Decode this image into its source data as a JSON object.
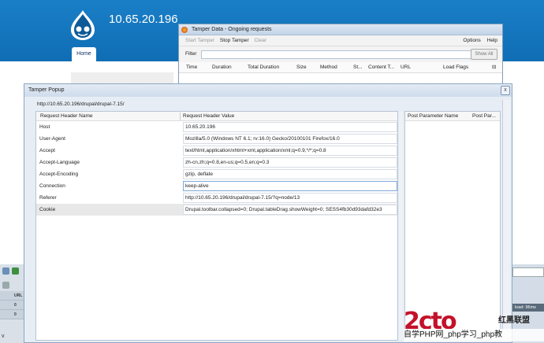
{
  "site": {
    "ip": "10.65.20.196",
    "home_tab": "Home",
    "corner_mark": "v"
  },
  "firefox_strip": {
    "row1": "URL",
    "row2": "0",
    "row3": "0"
  },
  "load_status": "load: 96ms",
  "tamper_data": {
    "title": "Tamper Data - Ongoing requests",
    "menu": {
      "start": "Start Tamper",
      "stop": "Stop Tamper",
      "clear": "Clear",
      "options": "Options",
      "help": "Help"
    },
    "filter_label": "Filter",
    "show_all": "Show All",
    "columns": [
      "Time",
      "Duration",
      "Total Duration",
      "Size",
      "Method",
      "St...",
      "Content T...",
      "URL",
      "Load Flags"
    ]
  },
  "popup": {
    "title": "Tamper Popup",
    "url": "http://10.65.20.196/drupal/drupal-7.15/",
    "close": "x",
    "request_header_name": "Request Header Name",
    "request_header_value": "Request Header Value",
    "post_parameter_name": "Post Parameter Name",
    "post_parameter_value": "Post Par...",
    "headers": [
      {
        "name": "Host",
        "value": "10.65.20.196"
      },
      {
        "name": "User-Agent",
        "value": "Mozilla/5.0 (Windows NT 6.1; rv:16.0) Gecko/20100101 Firefox/16.0"
      },
      {
        "name": "Accept",
        "value": "text/html,application/xhtml+xml,application/xml;q=0.9,*/*;q=0.8"
      },
      {
        "name": "Accept-Language",
        "value": "zh-cn,zh;q=0.8,en-us;q=0.5,en;q=0.3"
      },
      {
        "name": "Accept-Encoding",
        "value": "gzip, deflate"
      },
      {
        "name": "Connection",
        "value": "keep-alive"
      },
      {
        "name": "Referer",
        "value": "http://10.65.20.196/drupal/drupal-7.15/?q=node/13"
      },
      {
        "name": "Cookie",
        "value": "Drupal.toolbar.collapsed=0; Drupal.tableDrag.showWeight=0; SESS4fb30d93dafd32e3"
      }
    ]
  },
  "watermark": {
    "logo": "2cto",
    "mark": "红黑联盟",
    "text": "自学PHP网_php学习_php教"
  },
  "colors": {
    "drupal_blue": "#1576c0",
    "watermark_red": "#c3122a"
  }
}
